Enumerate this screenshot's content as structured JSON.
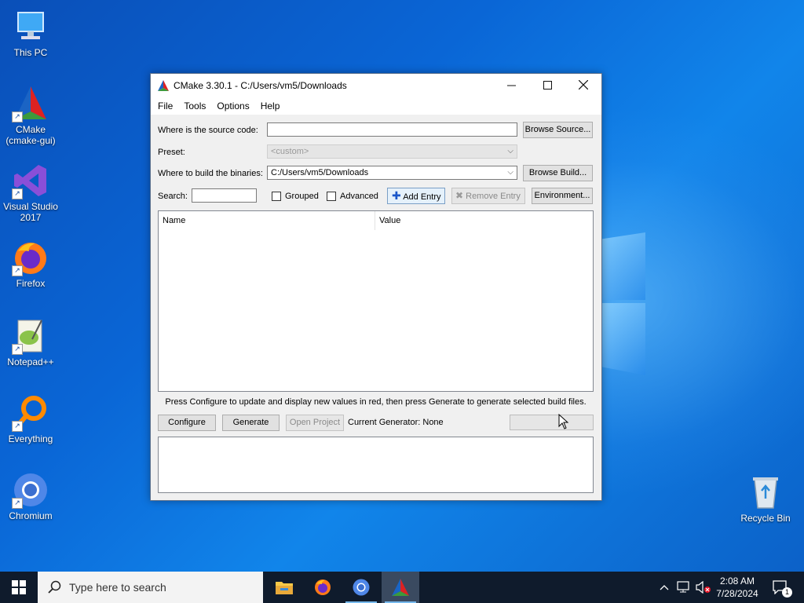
{
  "desktop": {
    "icons": [
      {
        "label": "This PC"
      },
      {
        "label": "CMake (cmake-gui)"
      },
      {
        "label": "Visual Studio 2017"
      },
      {
        "label": "Firefox"
      },
      {
        "label": "Notepad++"
      },
      {
        "label": "Everything"
      },
      {
        "label": "Chromium"
      },
      {
        "label": "Recycle Bin"
      }
    ]
  },
  "window": {
    "title": "CMake 3.30.1 - C:/Users/vm5/Downloads",
    "menu": [
      "File",
      "Tools",
      "Options",
      "Help"
    ],
    "source_label": "Where is the source code:",
    "source_value": "",
    "browse_source": "Browse Source...",
    "preset_label": "Preset:",
    "preset_value": "<custom>",
    "build_label": "Where to build the binaries:",
    "build_value": "C:/Users/vm5/Downloads",
    "browse_build": "Browse Build...",
    "search_label": "Search:",
    "search_value": "",
    "grouped_label": "Grouped",
    "grouped_checked": false,
    "advanced_label": "Advanced",
    "advanced_checked": false,
    "add_entry": "Add Entry",
    "remove_entry": "Remove Entry",
    "environment": "Environment...",
    "table": {
      "columns": [
        "Name",
        "Value"
      ],
      "rows": []
    },
    "hint": "Press Configure to update and display new values in red, then press Generate to generate selected build files.",
    "configure": "Configure",
    "generate": "Generate",
    "open_project": "Open Project",
    "current_generator": "Current Generator: None",
    "output": ""
  },
  "taskbar": {
    "search_placeholder": "Type here to search",
    "apps": [
      "File Explorer",
      "Firefox",
      "Chromium",
      "CMake"
    ],
    "time": "2:08 AM",
    "date": "7/28/2024",
    "notification_count": "1"
  }
}
